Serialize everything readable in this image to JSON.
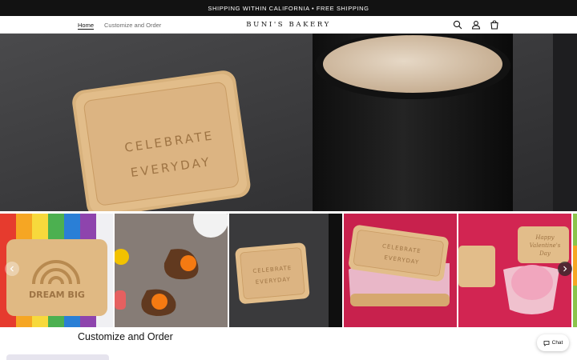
{
  "announcement": {
    "text": "SHIPPING WITHIN CALIFORNIA • FREE SHIPPING"
  },
  "nav": {
    "items": [
      {
        "label": "Home"
      },
      {
        "label": "Customize and Order"
      }
    ]
  },
  "brand": {
    "name": "BUNI'S BAKERY"
  },
  "icons": {
    "search": "search-icon",
    "account": "account-icon",
    "cart": "cart-icon",
    "chat": "chat-bubble-icon",
    "prev": "chevron-left-icon",
    "next": "chevron-right-icon"
  },
  "hero": {
    "cookie_line1": "CELEBRATE",
    "cookie_line2": "EVERYDAY"
  },
  "carousel": {
    "slides": [
      {
        "stamp": "DREAM BIG"
      },
      {
        "stamp": ""
      },
      {
        "stamp_line1": "CELEBRATE",
        "stamp_line2": "EVERYDAY"
      },
      {
        "stamp_line1": "CELEBRATE",
        "stamp_line2": "EVERYDAY"
      },
      {
        "stamp_line1": "Happy",
        "stamp_line2": "Valentine's",
        "stamp_line3": "Day"
      }
    ]
  },
  "section": {
    "title": "Customize and Order"
  },
  "chat": {
    "label": "Chat"
  },
  "colors": {
    "announcement_bg": "#121212",
    "hero_slate": "#3b3b3d",
    "cookie": "#e2bd8a",
    "rainbow": [
      "#e63b2e",
      "#f6a623",
      "#f7d93c",
      "#4cb050",
      "#2a7fd6",
      "#8e44ad"
    ],
    "pink_bg": "#c8214d"
  }
}
